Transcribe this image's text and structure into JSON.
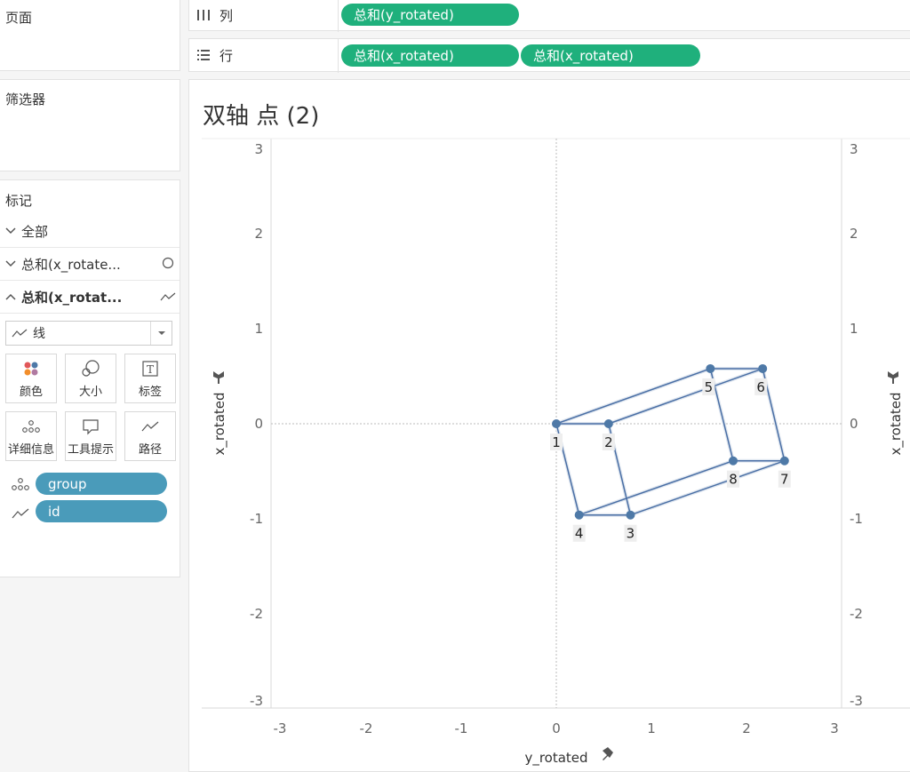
{
  "left_panel": {
    "pages_title": "页面",
    "filters_title": "筛选器",
    "marks_title": "标记",
    "marks_rows": [
      {
        "label": "全部",
        "chevron": "down",
        "icon": ""
      },
      {
        "label": "总和(x_rotate...",
        "chevron": "down",
        "icon": "circle-icon"
      },
      {
        "label": "总和(x_rotat...",
        "chevron": "up",
        "icon": "line-icon"
      }
    ],
    "mark_type": "线",
    "cards": [
      {
        "label": "颜色",
        "icon": "color-icon"
      },
      {
        "label": "大小",
        "icon": "size-icon"
      },
      {
        "label": "标签",
        "icon": "label-icon"
      },
      {
        "label": "详细信息",
        "icon": "detail-icon"
      },
      {
        "label": "工具提示",
        "icon": "tooltip-icon"
      },
      {
        "label": "路径",
        "icon": "path-icon"
      }
    ],
    "fields": [
      {
        "label": "group",
        "icon": "detail-icon"
      },
      {
        "label": "id",
        "icon": "path-icon"
      }
    ]
  },
  "shelves": {
    "columns": {
      "label": "列",
      "pills": [
        "总和(y_rotated)"
      ]
    },
    "rows": {
      "label": "行",
      "pills": [
        "总和(x_rotated)",
        "总和(x_rotated)"
      ]
    }
  },
  "view": {
    "title": "双轴 点 (2)"
  },
  "colors": {
    "green_pill": "#1fb07c",
    "blue_pill": "#4a9bba",
    "mark": "#4e79a7",
    "line": "#4a6fa5"
  },
  "chart_data": {
    "type": "line",
    "xlabel": "y_rotated",
    "ylabel": "x_rotated",
    "ylabel_right": "x_rotated",
    "xlim": [
      -3,
      3
    ],
    "ylim": [
      -3,
      3
    ],
    "x_ticks": [
      -3,
      -2,
      -1,
      0,
      1,
      2,
      3
    ],
    "y_ticks": [
      3,
      2,
      1,
      0,
      -1,
      -2,
      -3
    ],
    "points": [
      {
        "id": "1",
        "x": 0.0,
        "y": 0.0
      },
      {
        "id": "2",
        "x": 0.55,
        "y": 0.0
      },
      {
        "id": "3",
        "x": 0.78,
        "y": -0.96
      },
      {
        "id": "4",
        "x": 0.24,
        "y": -0.96
      },
      {
        "id": "5",
        "x": 1.62,
        "y": 0.58
      },
      {
        "id": "6",
        "x": 2.17,
        "y": 0.58
      },
      {
        "id": "7",
        "x": 2.4,
        "y": -0.39
      },
      {
        "id": "8",
        "x": 1.86,
        "y": -0.39
      }
    ],
    "segments": [
      [
        "1",
        "2"
      ],
      [
        "2",
        "3"
      ],
      [
        "3",
        "4"
      ],
      [
        "4",
        "1"
      ],
      [
        "5",
        "6"
      ],
      [
        "6",
        "7"
      ],
      [
        "7",
        "8"
      ],
      [
        "8",
        "5"
      ],
      [
        "1",
        "5"
      ],
      [
        "2",
        "6"
      ],
      [
        "3",
        "7"
      ],
      [
        "4",
        "8"
      ]
    ],
    "grid": false,
    "zero_lines": true
  }
}
